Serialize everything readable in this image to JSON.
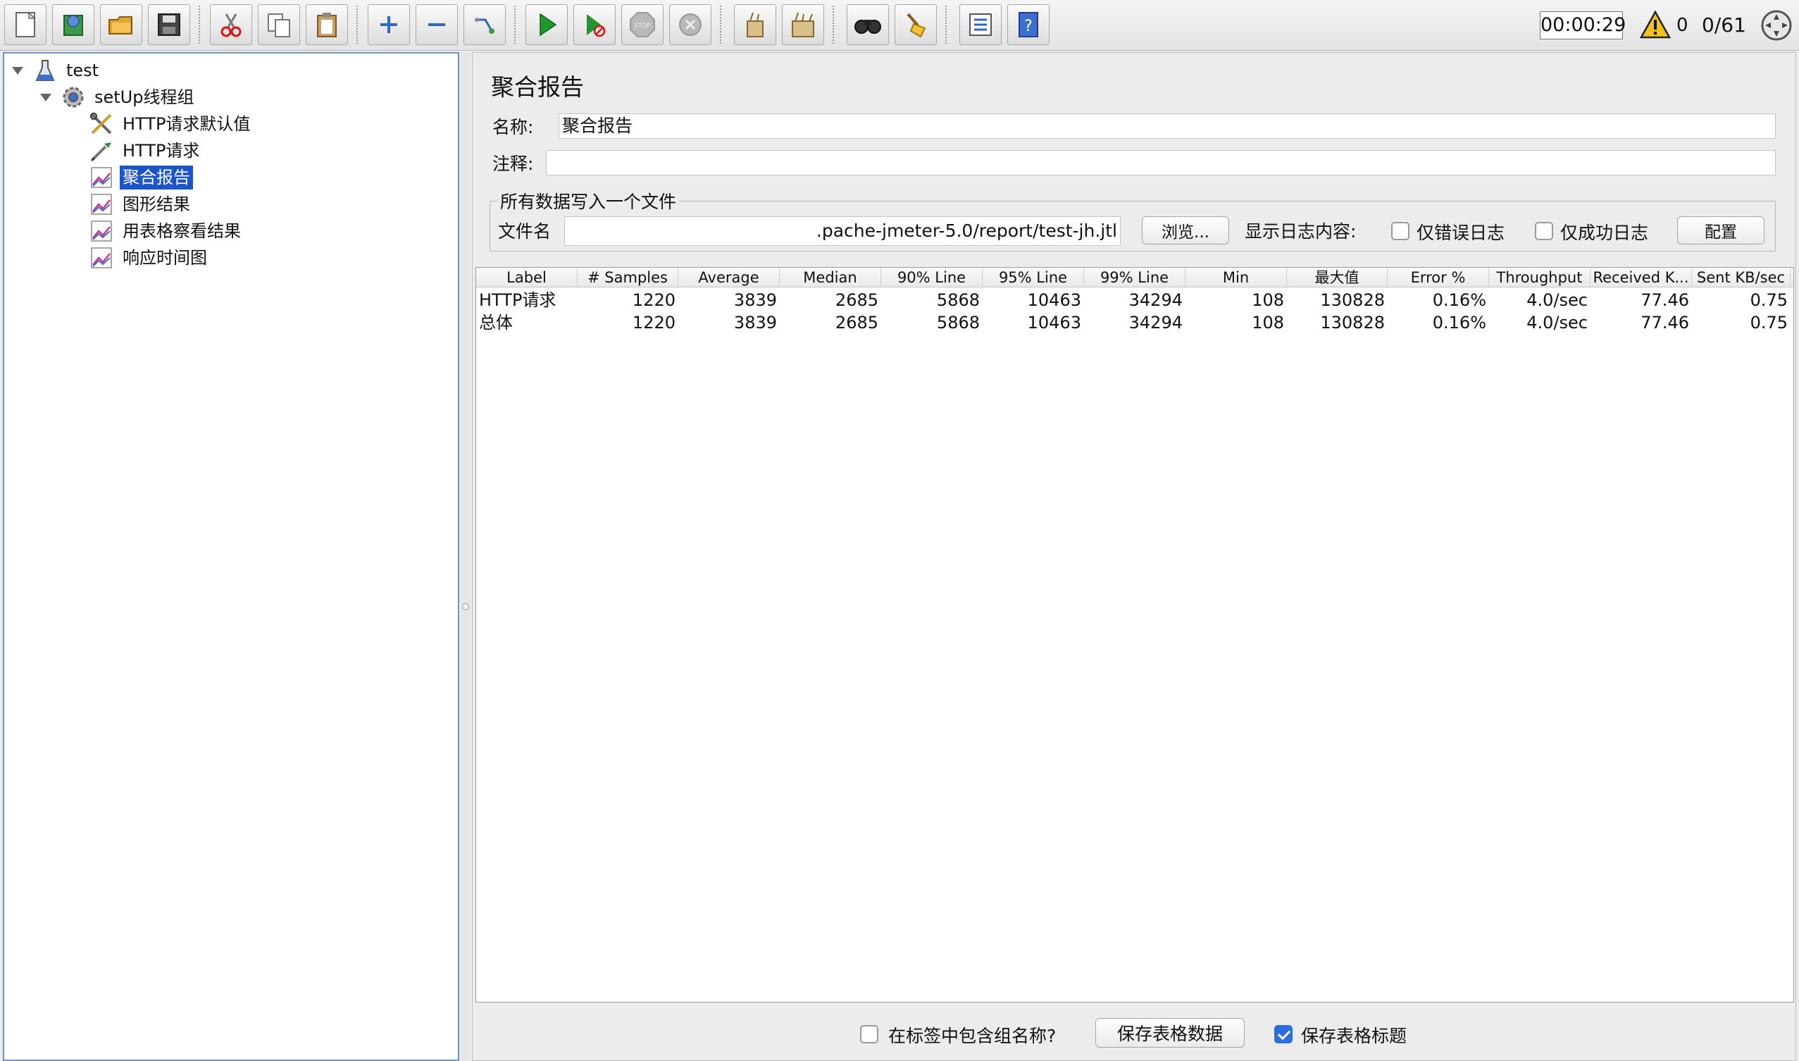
{
  "toolbar": {
    "buttons": [
      "new-icon",
      "templates-icon",
      "open-icon",
      "save-icon",
      "cut-icon",
      "copy-icon",
      "paste-icon",
      "expand-icon",
      "collapse-icon",
      "toggle-icon",
      "start-icon",
      "start-no-pause-icon",
      "stop-icon",
      "shutdown-icon",
      "clear-icon",
      "clear-all-icon",
      "search-icon",
      "reset-search-icon",
      "function-helper-icon",
      "help-icon"
    ],
    "elapsed_time": "00:00:29",
    "warning_count": "0",
    "active_threads": "0/61"
  },
  "tree": {
    "items": [
      {
        "label": "test",
        "icon": "flask-icon",
        "level": 0,
        "expanded": true
      },
      {
        "label": "setUp线程组",
        "icon": "gear-icon",
        "level": 1,
        "expanded": true
      },
      {
        "label": "HTTP请求默认值",
        "icon": "tools-icon",
        "level": 2
      },
      {
        "label": "HTTP请求",
        "icon": "pipette-icon",
        "level": 2
      },
      {
        "label": "聚合报告",
        "icon": "chart-icon",
        "level": 2,
        "selected": true
      },
      {
        "label": "图形结果",
        "icon": "chart-icon",
        "level": 2
      },
      {
        "label": "用表格察看结果",
        "icon": "chart-icon",
        "level": 2
      },
      {
        "label": "响应时间图",
        "icon": "chart-icon",
        "level": 2
      }
    ]
  },
  "report": {
    "title": "聚合报告",
    "name_label": "名称:",
    "name_value": "聚合报告",
    "comment_label": "注释:",
    "comment_value": "",
    "file_group_legend": "所有数据写入一个文件",
    "filename_label": "文件名",
    "filename_value": ".pache-jmeter-5.0/report/test-jh.jtl",
    "browse_button": "浏览...",
    "log_display_label": "显示日志内容:",
    "errors_only_label": "仅错误日志",
    "errors_only_checked": false,
    "success_only_label": "仅成功日志",
    "success_only_checked": false,
    "configure_button": "配置"
  },
  "table": {
    "columns": [
      "Label",
      "# Samples",
      "Average",
      "Median",
      "90% Line",
      "95% Line",
      "99% Line",
      "Min",
      "最大值",
      "Error %",
      "Throughput",
      "Received K...",
      "Sent KB/sec"
    ],
    "rows": [
      [
        "HTTP请求",
        "1220",
        "3839",
        "2685",
        "5868",
        "10463",
        "34294",
        "108",
        "130828",
        "0.16%",
        "4.0/sec",
        "77.46",
        "0.75"
      ],
      [
        "总体",
        "1220",
        "3839",
        "2685",
        "5868",
        "10463",
        "34294",
        "108",
        "130828",
        "0.16%",
        "4.0/sec",
        "77.46",
        "0.75"
      ]
    ]
  },
  "footer": {
    "include_group_label": "在标签中包含组名称?",
    "include_group_checked": false,
    "save_table_button": "保存表格数据",
    "save_header_label": "保存表格标题",
    "save_header_checked": true
  }
}
